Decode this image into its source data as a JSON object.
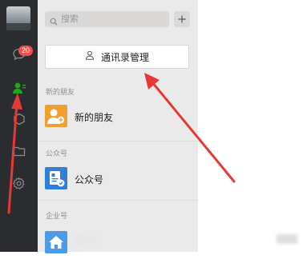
{
  "rail": {
    "message_badge": "20",
    "icons": [
      "avatar",
      "chat-icon",
      "contacts-icon",
      "favorites-icon",
      "folder-icon",
      "settings-icon"
    ]
  },
  "search": {
    "placeholder": "搜索"
  },
  "manage_button": {
    "label": "通讯录管理"
  },
  "sections": {
    "new_friends": {
      "label": "新的朋友",
      "item": "新的朋友"
    },
    "official": {
      "label": "公众号",
      "item": "公众号"
    },
    "enterprise": {
      "label": "企业号"
    }
  },
  "colors": {
    "rail_bg": "#2b2c2f",
    "panel_bg": "#eaeaea",
    "accent_green": "#1aad19",
    "badge_red": "#f74c4c",
    "new_friend_orange": "#f0a030",
    "official_blue": "#2f7fd8",
    "enterprise_blue": "#4a9be8",
    "annotation_red": "#e53935"
  }
}
